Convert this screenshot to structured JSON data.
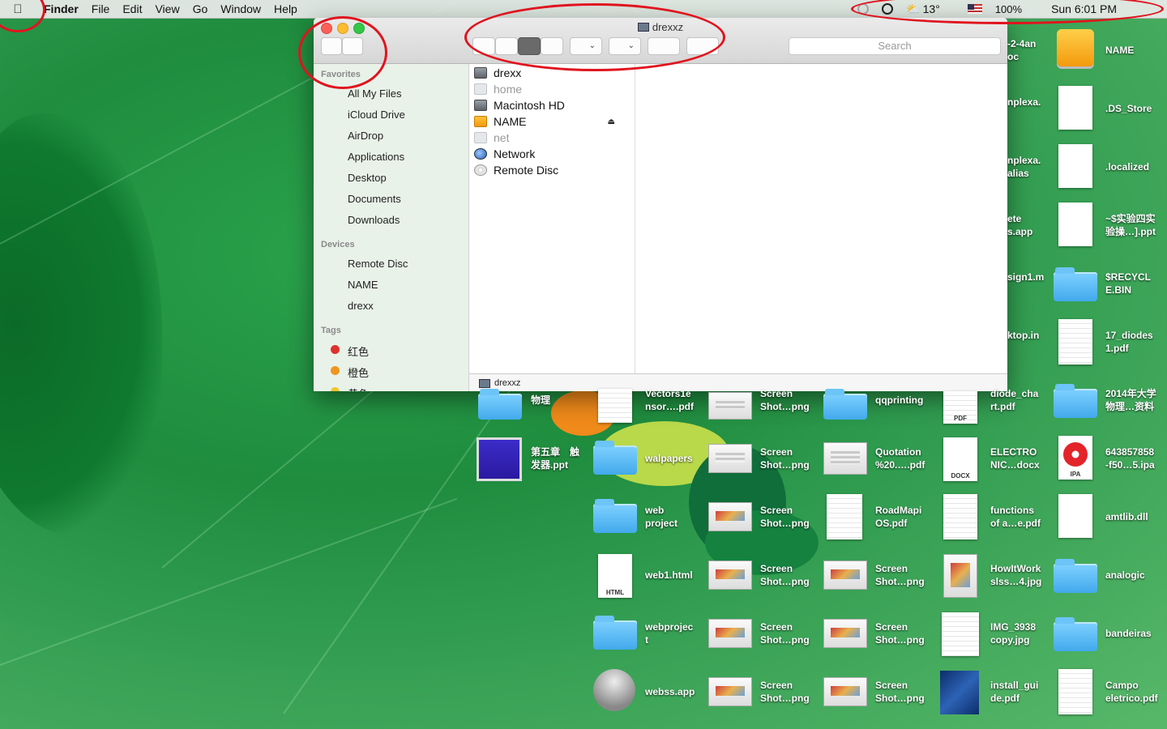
{
  "menubar": {
    "app": "Finder",
    "menus": [
      "File",
      "Edit",
      "View",
      "Go",
      "Window",
      "Help"
    ],
    "weather": "13°",
    "battery": "100%",
    "clock": "Sun 6:01 PM"
  },
  "window": {
    "title": "drexxz",
    "search_placeholder": "Search",
    "sidebar": {
      "favorites_header": "Favorites",
      "favorites": [
        "All My Files",
        "iCloud Drive",
        "AirDrop",
        "Applications",
        "Desktop",
        "Documents",
        "Downloads"
      ],
      "devices_header": "Devices",
      "devices": [
        "Remote Disc",
        "NAME",
        "drexx"
      ],
      "tags_header": "Tags",
      "tags": [
        {
          "label": "红色",
          "color": "#e0312b"
        },
        {
          "label": "橙色",
          "color": "#f0961e"
        },
        {
          "label": "黄色",
          "color": "#f3c52b"
        }
      ]
    },
    "column": [
      {
        "label": "drexx",
        "icon": "disk"
      },
      {
        "label": "home",
        "icon": "ghost"
      },
      {
        "label": "Macintosh HD",
        "icon": "disk"
      },
      {
        "label": "NAME",
        "icon": "orange"
      },
      {
        "label": "net",
        "icon": "ghost"
      },
      {
        "label": "Network",
        "icon": "globe"
      },
      {
        "label": "Remote Disc",
        "icon": "cd"
      }
    ],
    "pathbar": "drexxz"
  },
  "desktop": {
    "right_col": [
      "NAME",
      ".DS_Store",
      ".localized",
      "~$实验四实\n验操…].ppt",
      "$RECYCL\nE.BIN",
      "17_diodes\n1.pdf",
      "2014年大学\n物理…资料",
      "643857858\n-f50…5.ipa",
      "amtlib.dll",
      "analogic",
      "bandeiras",
      "Campo\neletrico.pdf"
    ],
    "partial_col": [
      "-2-4an\noc",
      "nplexa.",
      "nplexa.\nalias",
      "ete\ns.app",
      "sign1.m",
      "ktop.in"
    ],
    "col_diode": [
      "diode_cha\nrt.pdf",
      "ELECTRO\nNIC…docx",
      "functions\nof a…e.pdf",
      "HowItWork\nslss…4.jpg",
      "IMG_3938\ncopy.jpg",
      "install_gui\nde.pdf"
    ],
    "col_qq": [
      "qqprinting",
      "Quotation\n%20.….pdf",
      "RoadMapi\nOS.pdf",
      "Screen\nShot…png",
      "Screen\nShot…png",
      "Screen\nShot…png"
    ],
    "col_screen": [
      "Screen\nShot…png",
      "Screen\nShot…png",
      "Screen\nShot…png",
      "Screen\nShot…png",
      "Screen\nShot…png",
      "Screen\nShot…png"
    ],
    "col_vectors": [
      "Vectors1e\nnsor….pdf",
      "walpapers",
      "web\nproject",
      "web1.html",
      "webprojec\nt",
      "webss.app"
    ],
    "col_left": [
      "物理",
      "第五章　触\n发器.ppt"
    ],
    "badges": {
      "pdf": "PDF",
      "docx": "DOCX",
      "ipa": "IPA",
      "html": "HTML"
    }
  }
}
